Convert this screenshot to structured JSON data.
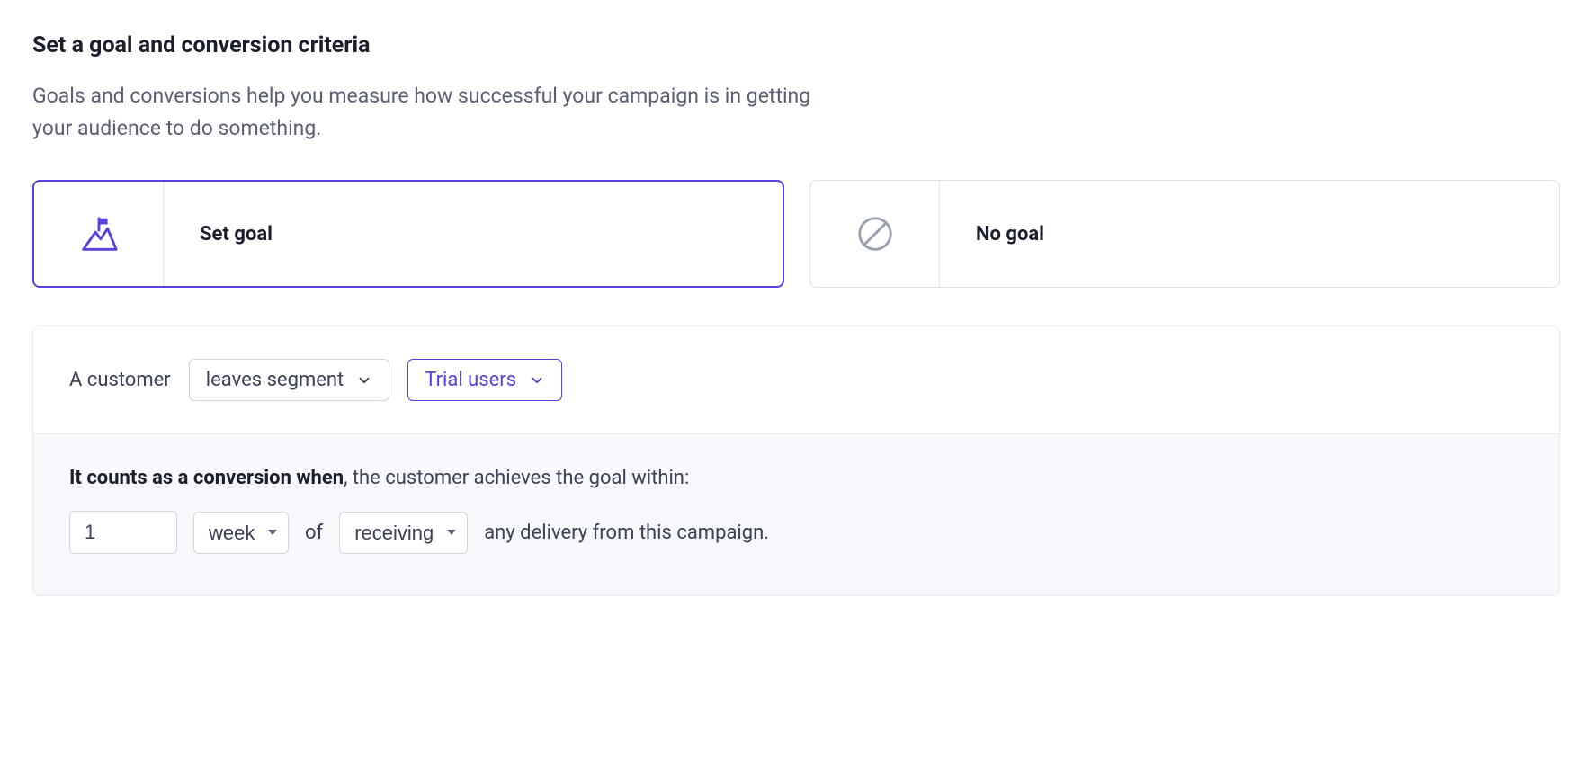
{
  "heading": "Set a goal and conversion criteria",
  "subheading": "Goals and conversions help you measure how successful your campaign is in getting your audience to do something.",
  "options": {
    "set_goal": "Set goal",
    "no_goal": "No goal"
  },
  "config": {
    "prefix": "A customer",
    "action_dropdown": "leaves segment",
    "segment_dropdown": "Trial users",
    "conversion_strong": "It counts as a conversion when",
    "conversion_rest": ", the customer achieves the goal within:",
    "duration_value": "1",
    "duration_unit": "week",
    "of_label": "of",
    "event_type": "receiving",
    "trailing": "any delivery from this campaign."
  },
  "colors": {
    "accent": "#5b3fe0",
    "muted_icon": "#9aa0ae"
  }
}
